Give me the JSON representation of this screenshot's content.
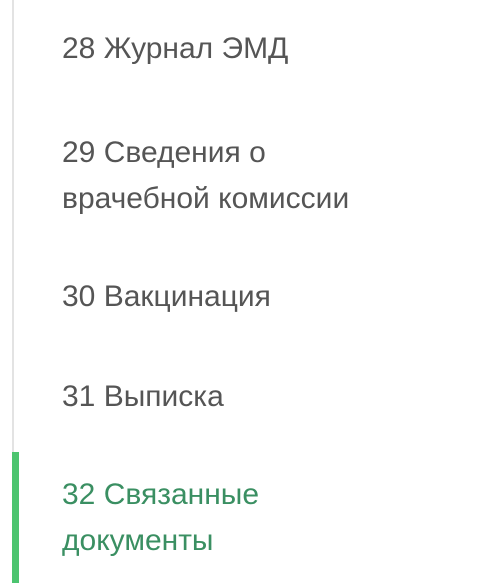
{
  "nav": {
    "items": [
      {
        "label": "28 Журнал ЭМД",
        "active": false
      },
      {
        "label": "29 Сведения о\nврачебной комиссии",
        "active": false
      },
      {
        "label": "30 Вакцинация",
        "active": false
      },
      {
        "label": "31 Выписка",
        "active": false
      },
      {
        "label": "32 Связанные\nдокументы",
        "active": true
      }
    ],
    "colors": {
      "text": "#555555",
      "active_text": "#3a8f62",
      "active_bar": "#4cc46f",
      "track": "#e3e3e3"
    }
  }
}
